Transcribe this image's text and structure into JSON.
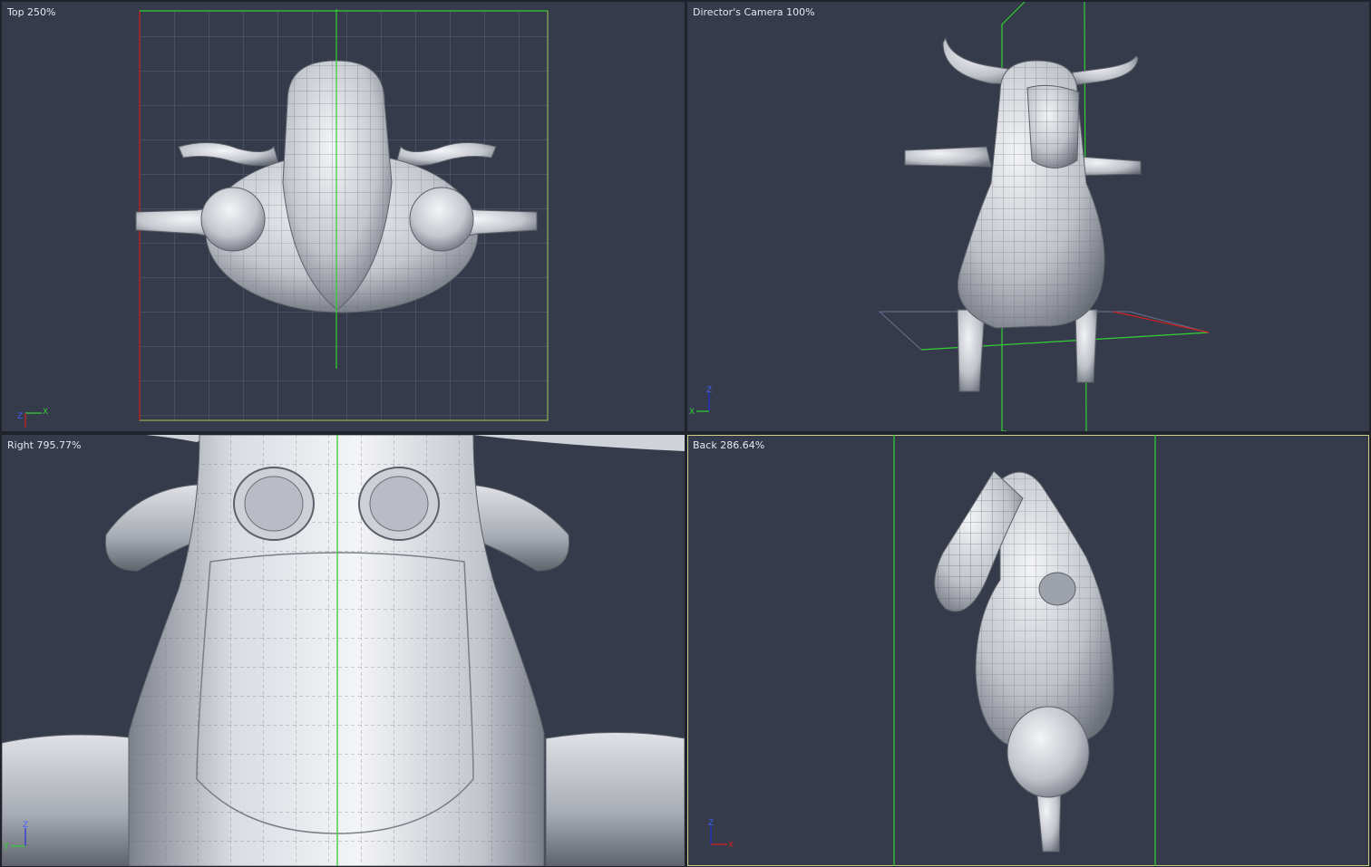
{
  "viewports": {
    "top": {
      "label": "Top 250%",
      "axis": {
        "vertical": "Z",
        "horizontal": "X"
      }
    },
    "camera": {
      "label": "Director's Camera 100%",
      "axis": {
        "vertical": "Z",
        "horizontal": "X"
      }
    },
    "right": {
      "label": "Right 795.77%",
      "axis": {
        "vertical": "Z",
        "horizontal": "Y"
      }
    },
    "back": {
      "label": "Back 286.64%",
      "axis": {
        "vertical": "Z",
        "horizontal": "X"
      }
    }
  },
  "colors": {
    "viewport_bg": "#353b4b",
    "grid": "#5a6078",
    "axis_x": "#d02020",
    "axis_y": "#30d030",
    "axis_z": "#2030e0",
    "mesh_light": "#e9ebef",
    "mesh_dark": "#6f737c",
    "wire": "#5c6068"
  }
}
